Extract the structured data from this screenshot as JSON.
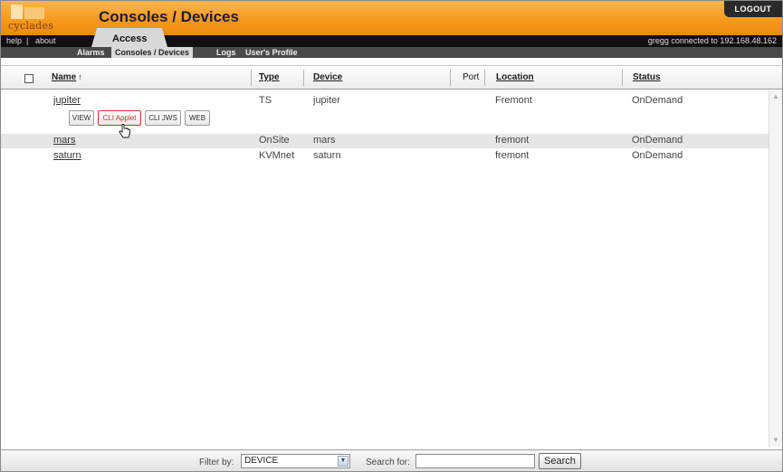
{
  "header": {
    "logo_text": "cyclades",
    "title": "Consoles / Devices",
    "logout_label": "LOGOUT"
  },
  "navbar": {
    "help": "help",
    "separator": "|",
    "about": "about",
    "access_tab": "Access",
    "connection_status": "gregg connected to 192.168.48.162"
  },
  "subnav": {
    "alarms": "Alarms",
    "consoles": "Consoles / Devices",
    "logs": "Logs",
    "profile": "User's Profile"
  },
  "table": {
    "headers": {
      "name": "Name",
      "sort_indicator": "↑",
      "type": "Type",
      "device": "Device",
      "port": "Port",
      "location": "Location",
      "status": "Status"
    },
    "rows": [
      {
        "name": "jupiter",
        "type": "TS",
        "device": "jupiter",
        "port": "",
        "location": "Fremont",
        "status": "OnDemand"
      },
      {
        "name": "mars",
        "type": "OnSite",
        "device": "mars",
        "port": "",
        "location": "fremont",
        "status": "OnDemand"
      },
      {
        "name": "saturn",
        "type": "KVMnet",
        "device": "saturn",
        "port": "",
        "location": "fremont",
        "status": "OnDemand"
      }
    ],
    "row_actions": {
      "view": "VIEW",
      "cli_applet": "CLI Applet",
      "cli_jws": "CLI JWS",
      "web": "WEB"
    }
  },
  "footer": {
    "filter_label": "Filter by:",
    "filter_value": "DEVICE",
    "search_label": "Search for:",
    "search_value": "",
    "search_button": "Search"
  },
  "colors": {
    "header_orange": "#f49a1e",
    "nav_black": "#101010",
    "subnav_gray": "#4a4a4a",
    "title_text": "#1d1d3b",
    "selected_row": "#e6e6e6",
    "highlight_action": "#c0392b"
  },
  "icons": {
    "sort": "arrow-up-icon",
    "cursor": "hand-pointer-icon",
    "scroll_up": "scroll-up-arrow-icon",
    "scroll_down": "scroll-down-arrow-icon",
    "dropdown": "chevron-down-icon"
  }
}
